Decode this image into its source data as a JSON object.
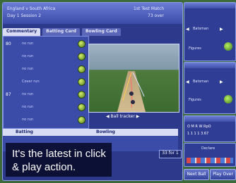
{
  "header": {
    "match": "England v South Africa",
    "day": "Day 1 Session 2",
    "mode": "1st Test Match",
    "overs": "73 over"
  },
  "tabs": [
    "Commentary",
    "Batting Card",
    "Bowling Card"
  ],
  "commentary": [
    {
      "over": "80",
      "text": "no run"
    },
    {
      "over": "",
      "text": "no run"
    },
    {
      "over": "",
      "text": "no run"
    },
    {
      "over": "",
      "text": "Cover run"
    },
    {
      "over": "87",
      "text": "no run"
    },
    {
      "over": "",
      "text": "no run"
    },
    {
      "over": "",
      "text": "no run"
    }
  ],
  "tracker": {
    "label": "Ball tracker"
  },
  "betting": {
    "batting": "Batting",
    "bowling": "Bowling"
  },
  "score": "33 for 1",
  "right_panels": {
    "batsman_top": {
      "name": "Batsman",
      "figures": "Figures"
    },
    "batsman_bottom": {
      "name": "Batsman",
      "figures": "Figures"
    },
    "scoreline": "O  M  R  W  RpO",
    "scoreline_values": "1  1  1  1  3.67",
    "declare": "Declare"
  },
  "buttons": {
    "next_ball": "Next Ball",
    "play_over": "Play Over"
  },
  "caption": "It's the latest in click & play action.",
  "colors": {
    "panel": "#2d3a8c",
    "accent": "#d8dcf4",
    "field": "#3c6a3a"
  }
}
